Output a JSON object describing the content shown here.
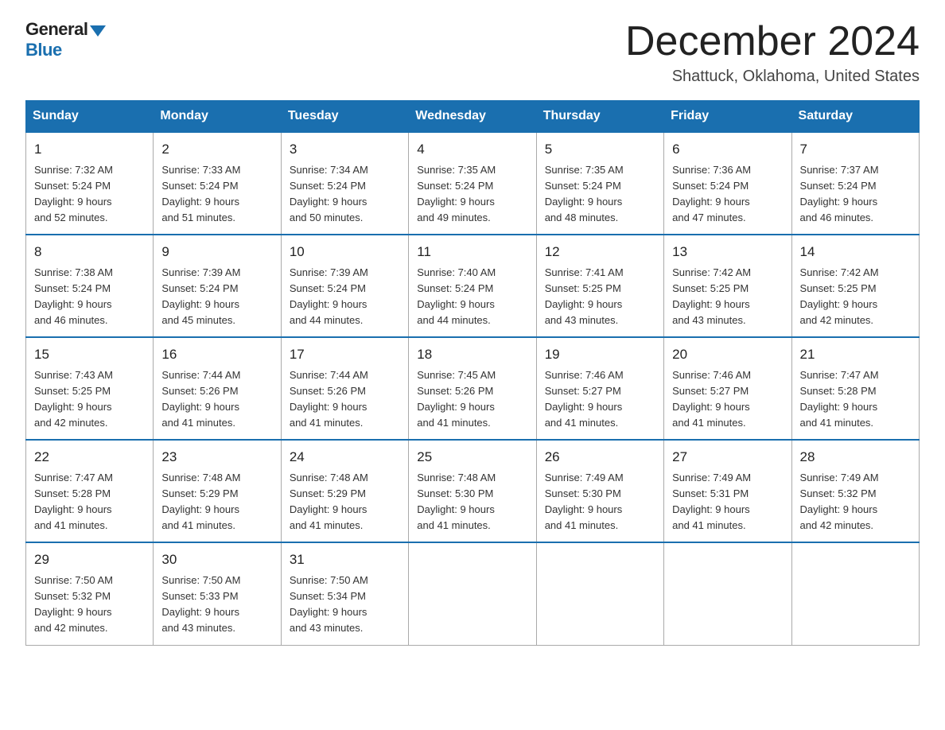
{
  "logo": {
    "general": "General",
    "blue": "Blue"
  },
  "header": {
    "month": "December 2024",
    "location": "Shattuck, Oklahoma, United States"
  },
  "weekdays": [
    "Sunday",
    "Monday",
    "Tuesday",
    "Wednesday",
    "Thursday",
    "Friday",
    "Saturday"
  ],
  "weeks": [
    [
      {
        "day": "1",
        "sunrise": "7:32 AM",
        "sunset": "5:24 PM",
        "daylight": "9 hours and 52 minutes."
      },
      {
        "day": "2",
        "sunrise": "7:33 AM",
        "sunset": "5:24 PM",
        "daylight": "9 hours and 51 minutes."
      },
      {
        "day": "3",
        "sunrise": "7:34 AM",
        "sunset": "5:24 PM",
        "daylight": "9 hours and 50 minutes."
      },
      {
        "day": "4",
        "sunrise": "7:35 AM",
        "sunset": "5:24 PM",
        "daylight": "9 hours and 49 minutes."
      },
      {
        "day": "5",
        "sunrise": "7:35 AM",
        "sunset": "5:24 PM",
        "daylight": "9 hours and 48 minutes."
      },
      {
        "day": "6",
        "sunrise": "7:36 AM",
        "sunset": "5:24 PM",
        "daylight": "9 hours and 47 minutes."
      },
      {
        "day": "7",
        "sunrise": "7:37 AM",
        "sunset": "5:24 PM",
        "daylight": "9 hours and 46 minutes."
      }
    ],
    [
      {
        "day": "8",
        "sunrise": "7:38 AM",
        "sunset": "5:24 PM",
        "daylight": "9 hours and 46 minutes."
      },
      {
        "day": "9",
        "sunrise": "7:39 AM",
        "sunset": "5:24 PM",
        "daylight": "9 hours and 45 minutes."
      },
      {
        "day": "10",
        "sunrise": "7:39 AM",
        "sunset": "5:24 PM",
        "daylight": "9 hours and 44 minutes."
      },
      {
        "day": "11",
        "sunrise": "7:40 AM",
        "sunset": "5:24 PM",
        "daylight": "9 hours and 44 minutes."
      },
      {
        "day": "12",
        "sunrise": "7:41 AM",
        "sunset": "5:25 PM",
        "daylight": "9 hours and 43 minutes."
      },
      {
        "day": "13",
        "sunrise": "7:42 AM",
        "sunset": "5:25 PM",
        "daylight": "9 hours and 43 minutes."
      },
      {
        "day": "14",
        "sunrise": "7:42 AM",
        "sunset": "5:25 PM",
        "daylight": "9 hours and 42 minutes."
      }
    ],
    [
      {
        "day": "15",
        "sunrise": "7:43 AM",
        "sunset": "5:25 PM",
        "daylight": "9 hours and 42 minutes."
      },
      {
        "day": "16",
        "sunrise": "7:44 AM",
        "sunset": "5:26 PM",
        "daylight": "9 hours and 41 minutes."
      },
      {
        "day": "17",
        "sunrise": "7:44 AM",
        "sunset": "5:26 PM",
        "daylight": "9 hours and 41 minutes."
      },
      {
        "day": "18",
        "sunrise": "7:45 AM",
        "sunset": "5:26 PM",
        "daylight": "9 hours and 41 minutes."
      },
      {
        "day": "19",
        "sunrise": "7:46 AM",
        "sunset": "5:27 PM",
        "daylight": "9 hours and 41 minutes."
      },
      {
        "day": "20",
        "sunrise": "7:46 AM",
        "sunset": "5:27 PM",
        "daylight": "9 hours and 41 minutes."
      },
      {
        "day": "21",
        "sunrise": "7:47 AM",
        "sunset": "5:28 PM",
        "daylight": "9 hours and 41 minutes."
      }
    ],
    [
      {
        "day": "22",
        "sunrise": "7:47 AM",
        "sunset": "5:28 PM",
        "daylight": "9 hours and 41 minutes."
      },
      {
        "day": "23",
        "sunrise": "7:48 AM",
        "sunset": "5:29 PM",
        "daylight": "9 hours and 41 minutes."
      },
      {
        "day": "24",
        "sunrise": "7:48 AM",
        "sunset": "5:29 PM",
        "daylight": "9 hours and 41 minutes."
      },
      {
        "day": "25",
        "sunrise": "7:48 AM",
        "sunset": "5:30 PM",
        "daylight": "9 hours and 41 minutes."
      },
      {
        "day": "26",
        "sunrise": "7:49 AM",
        "sunset": "5:30 PM",
        "daylight": "9 hours and 41 minutes."
      },
      {
        "day": "27",
        "sunrise": "7:49 AM",
        "sunset": "5:31 PM",
        "daylight": "9 hours and 41 minutes."
      },
      {
        "day": "28",
        "sunrise": "7:49 AM",
        "sunset": "5:32 PM",
        "daylight": "9 hours and 42 minutes."
      }
    ],
    [
      {
        "day": "29",
        "sunrise": "7:50 AM",
        "sunset": "5:32 PM",
        "daylight": "9 hours and 42 minutes."
      },
      {
        "day": "30",
        "sunrise": "7:50 AM",
        "sunset": "5:33 PM",
        "daylight": "9 hours and 43 minutes."
      },
      {
        "day": "31",
        "sunrise": "7:50 AM",
        "sunset": "5:34 PM",
        "daylight": "9 hours and 43 minutes."
      },
      null,
      null,
      null,
      null
    ]
  ],
  "labels": {
    "sunrise": "Sunrise:",
    "sunset": "Sunset:",
    "daylight": "Daylight:"
  }
}
